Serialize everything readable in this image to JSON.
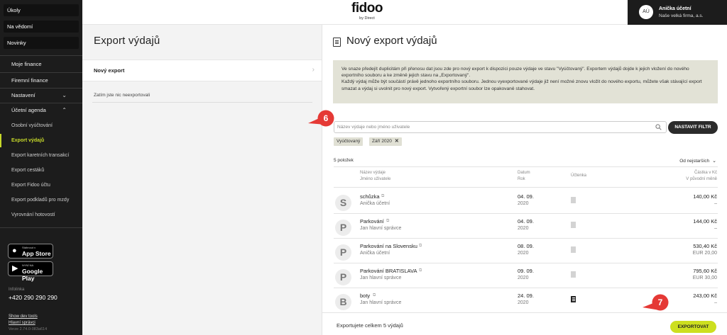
{
  "sidebar": {
    "top_buttons": [
      "Úkoly",
      "Na vědomí",
      "Novinky"
    ],
    "items": [
      {
        "label": "Moje finance"
      },
      {
        "label": "Firemní finance"
      },
      {
        "label": "Nastavení"
      },
      {
        "label": "Účetní agenda"
      },
      {
        "label": "Osobní vyúčtování"
      },
      {
        "label": "Export výdajů"
      },
      {
        "label": "Export karetních transakcí"
      },
      {
        "label": "Export cestáků"
      },
      {
        "label": "Export Fidoo účtu"
      },
      {
        "label": "Export podkladů pro mzdy"
      },
      {
        "label": "Vyrovnání hotovostí"
      }
    ],
    "app_store": {
      "small": "Stáhnout v",
      "big": "App Store"
    },
    "google_play": {
      "small": "NYNÍ NA",
      "big": "Google Play"
    },
    "infoline_label": "Infolinka",
    "phone": "+420 290 290 290",
    "links": [
      "Show dev tools",
      "Hlavní správci"
    ],
    "version": "Verze 2.74.0-083a614"
  },
  "header": {
    "logo": "fidoo",
    "logo_sub": "by Direct",
    "user": {
      "initials": "AÚ",
      "name": "Anička účetní",
      "company": "Naše velká firma, a.s."
    }
  },
  "left_panel": {
    "title": "Export výdajů",
    "nav_item": "Nový export",
    "empty_text": "Zatím jste nic neexportovali"
  },
  "right_panel": {
    "title": "Nový export výdajů",
    "info_p1": "Ve snaze předejít duplicitám při přenosu dat jsou zde pro nový export k dispozici pouze výdaje ve stavu \"Vyúčtovaný\". Exportem výdajů dojde k jejich vložení do nového exportního souboru a ke změně jejich stavu na „Exportovaný\".",
    "info_p2": "Každý výdaj může být součástí právě jednoho exportního souboru. Jednou vyexportované výdaje již není možné znovu vložit do nového exportu, můžete však stávající export smazat a výdaj si uvolnit pro nový export. Vytvořený exportní soubor lze opakovaně stahovat.",
    "search_placeholder": "Název výdaje nebo jméno uživatele",
    "filter_button": "NASTAVIT FILTR",
    "chips": [
      "Vyúčtovaný",
      "Září 2020"
    ],
    "count": "5 položek",
    "sort": "Od nejstarších",
    "headers": {
      "name": "Název výdaje",
      "user": "Jméno uživatele",
      "date": "Datum",
      "year": "Rok",
      "receipt": "Účtenka",
      "amount": "Částka v Kč",
      "orig": "V původní měně"
    },
    "rows": [
      {
        "initial": "S",
        "name": "schůzka",
        "user": "Anička účetní",
        "date": "04. 09.",
        "year": "2020",
        "receipt": "missing",
        "amount": "140,00 Kč",
        "orig": "–"
      },
      {
        "initial": "P",
        "name": "Parkování",
        "user": "Jan hlavní správce",
        "date": "04. 09.",
        "year": "2020",
        "receipt": "missing",
        "amount": "144,00 Kč",
        "orig": "–"
      },
      {
        "initial": "P",
        "name": "Parkování na Slovensku",
        "user": "Anička účetní",
        "date": "08. 09.",
        "year": "2020",
        "receipt": "missing",
        "amount": "530,40 Kč",
        "orig": "EUR 20,00"
      },
      {
        "initial": "P",
        "name": "Parkování BRATISLAVA",
        "user": "Jan hlavní správce",
        "date": "09. 09.",
        "year": "2020",
        "receipt": "missing",
        "amount": "795,60 Kč",
        "orig": "EUR 30,00"
      },
      {
        "initial": "B",
        "name": "boty",
        "user": "Jan hlavní správce",
        "date": "24. 09.",
        "year": "2020",
        "receipt": "attached",
        "amount": "243,00 Kč",
        "orig": "–"
      }
    ],
    "footer_text": "Exportujete celkem 5 výdajů",
    "export_button": "EXPORTOVAT"
  },
  "callouts": [
    {
      "number": "6"
    },
    {
      "number": "7"
    }
  ],
  "colors": {
    "accent": "#cddf1f",
    "sidebar_bg": "#1c1c1c",
    "callout": "#e53935",
    "info_bg": "#e2e2d6"
  }
}
